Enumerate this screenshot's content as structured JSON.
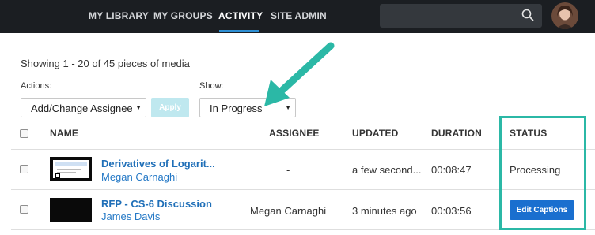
{
  "nav": {
    "items": [
      {
        "label": "MY LIBRARY"
      },
      {
        "label": "MY GROUPS"
      },
      {
        "label": "ACTIVITY"
      },
      {
        "label": "SITE ADMIN"
      }
    ],
    "active_item": "ACTIVITY",
    "accent_color": "#2d8fd4"
  },
  "summary": "Showing 1 - 20 of 45 pieces of media",
  "actions": {
    "label": "Actions:",
    "selected": "Add/Change Assignee",
    "apply_label": "Apply"
  },
  "show": {
    "label": "Show:",
    "selected": "In Progress"
  },
  "table": {
    "headers": {
      "name": "NAME",
      "assignee": "ASSIGNEE",
      "updated": "UPDATED",
      "duration": "DURATION",
      "status": "STATUS"
    },
    "rows": [
      {
        "title": "Derivatives of Logarit...",
        "owner": "Megan Carnaghi",
        "assignee": "-",
        "updated": "a few second...",
        "duration": "00:08:47",
        "status": "Processing"
      },
      {
        "title": "RFP - CS-6 Discussion",
        "owner": "James Davis",
        "assignee": "Megan Carnaghi",
        "updated": "3 minutes ago",
        "duration": "00:03:56",
        "status_button": "Edit Captions"
      }
    ]
  },
  "annotation_color": "#2bb8a6"
}
